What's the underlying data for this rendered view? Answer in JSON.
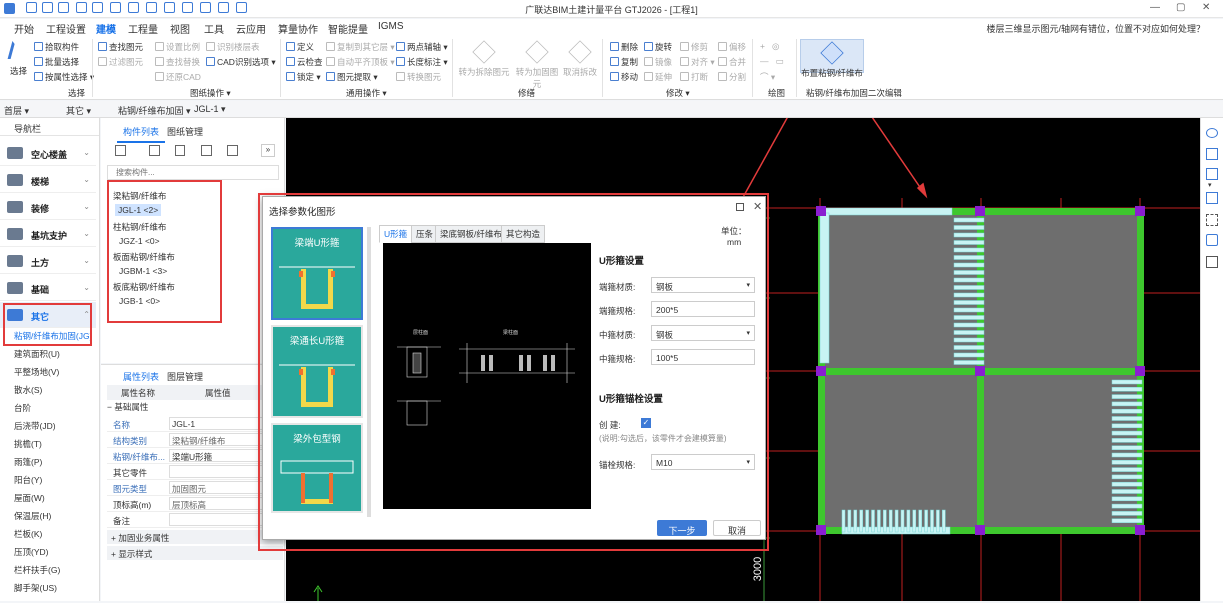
{
  "app": {
    "title": "广联达BIM土建计量平台 GTJ2026 - [工程1]",
    "hint": "楼层三维显示图元/轴网有错位，位置不对应如何处理？"
  },
  "menu": [
    "开始",
    "工程设置",
    "建模",
    "工程量",
    "视图",
    "工具",
    "云应用",
    "算量协作",
    "智能提量",
    "IGMS"
  ],
  "ribbon": {
    "select_group": {
      "select": "选择",
      "pick": "拾取构件",
      "batch": "批量选择",
      "by_attr": "按属性选择",
      "label": "选择"
    },
    "drawing_group": {
      "find": "查找图元",
      "filter": "过滤图元",
      "scale": "设置比例",
      "find_replace": "查找替换",
      "restore": "还原CAD",
      "recognize_layer": "识别楼层表",
      "cad_options": "CAD识别选项",
      "label": "图纸操作"
    },
    "common_group": {
      "define": "定义",
      "cloud_check": "云检查",
      "lock": "锁定",
      "copy_other": "复制到其它层",
      "auto_flat": "自动平齐顶板",
      "extract": "图元提取",
      "two_point": "两点辅轴",
      "length_mark": "长度标注",
      "convert": "转换图元",
      "label": "通用操作"
    },
    "modify_edit": {
      "to_demolish": "转为拆除图元",
      "to_reinforce": "转为加固图元",
      "cancel_modify": "取消拆改",
      "label": "修缮"
    },
    "modify_group": {
      "delete": "删除",
      "copy": "复制",
      "move": "移动",
      "rotate": "旋转",
      "mirror": "镜像",
      "extend": "延伸",
      "trim": "修剪",
      "align": "对齐",
      "break": "打断",
      "offset": "偏移",
      "merge": "合并",
      "split": "分割",
      "label": "修改"
    },
    "draw_group": {
      "label": "绘图"
    },
    "layout_group": {
      "layout": "布置粘钢/纤维布",
      "label": "粘钢/纤维布加固二次编辑"
    }
  },
  "toolbar2": {
    "floor": "首层",
    "type": "其它",
    "category": "粘钢/纤维布加固",
    "component": "JGL-1"
  },
  "nav": {
    "header": "导航栏",
    "categories": [
      "空心楼盖",
      "楼梯",
      "装修",
      "基坑支护",
      "土方",
      "基础",
      "其它"
    ],
    "sub_items": [
      "粘钢/纤维布加固(JG)",
      "建筑面积(U)",
      "平整场地(V)",
      "散水(S)",
      "台阶",
      "后浇带(JD)",
      "挑檐(T)",
      "雨篷(P)",
      "阳台(Y)",
      "屋面(W)",
      "保温层(H)",
      "栏板(K)",
      "压顶(YD)",
      "栏杆扶手(G)",
      "脚手架(US)"
    ]
  },
  "component_panel": {
    "tabs": [
      "构件列表",
      "图纸管理"
    ],
    "search_placeholder": "搜索构件...",
    "tree": [
      {
        "group": "梁粘钢/纤维布",
        "items": [
          "JGL-1 <2>"
        ]
      },
      {
        "group": "柱粘钢/纤维布",
        "items": [
          "JGZ-1 <0>"
        ]
      },
      {
        "group": "板面粘钢/纤维布",
        "items": [
          "JGBM-1 <3>"
        ]
      },
      {
        "group": "板底粘钢/纤维布",
        "items": [
          "JGB-1 <0>"
        ]
      }
    ]
  },
  "properties": {
    "tabs": [
      "属性列表",
      "图层管理"
    ],
    "headers": [
      "属性名称",
      "属性值"
    ],
    "section": "基础属性",
    "rows": [
      {
        "name": "名称",
        "value": "JGL-1"
      },
      {
        "name": "结构类别",
        "value": "梁粘钢/纤维布"
      },
      {
        "name": "粘钢/纤维布...",
        "value": "梁端U形箍"
      },
      {
        "name": "其它零件",
        "value": ""
      },
      {
        "name": "图元类型",
        "value": "加固图元"
      },
      {
        "name": "顶标高(m)",
        "value": "层顶标高"
      },
      {
        "name": "备注",
        "value": ""
      }
    ],
    "collapsed": [
      "加固业务属性",
      "显示样式"
    ]
  },
  "dialog": {
    "title": "选择参数化图形",
    "thumbnails": [
      "梁端U形箍",
      "梁通长U形箍",
      "梁外包型钢"
    ],
    "tabs": [
      "U形箍",
      "压条",
      "梁底钢板/纤维布",
      "其它构造"
    ],
    "unit_label": "单位：",
    "unit": "mm",
    "preview_labels": [
      "层柱面",
      "梁柱面"
    ],
    "u_setting": "U形箍设置",
    "fields": [
      {
        "label": "端箍材质:",
        "value": "钢板",
        "type": "select"
      },
      {
        "label": "端箍规格:",
        "value": "200*5",
        "type": "input"
      },
      {
        "label": "中箍材质:",
        "value": "钢板",
        "type": "select"
      },
      {
        "label": "中箍规格:",
        "value": "100*5",
        "type": "input"
      }
    ],
    "anchor_setting": "U形箍锚栓设置",
    "create_label": "创    建:",
    "create_note": "(说明:勾选后，该零件才会建模算量)",
    "anchor_spec_label": "锚栓规格:",
    "anchor_spec_value": "M10",
    "next": "下一步",
    "cancel": "取消"
  },
  "canvas": {
    "dimension": "3000"
  },
  "colors": {
    "accent": "#1a73e8",
    "highlight": "#e23b3b",
    "teal": "#2aa89c",
    "beam_green": "#3ec72e"
  }
}
